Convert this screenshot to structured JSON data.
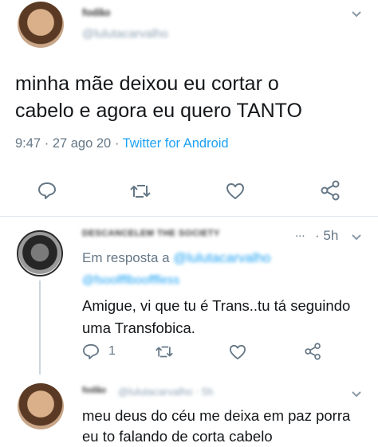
{
  "main_tweet": {
    "display_name": "fodão",
    "handle": "@lulutacarvalho",
    "text_line1": "minha mãe deixou eu cortar o",
    "text_line2": "cabelo e agora eu quero TANTO",
    "time": "9:47",
    "sep1": "·",
    "date": "27 ago 20",
    "sep2": "·",
    "source": "Twitter for Android"
  },
  "reply1": {
    "display_name": "DESCANCELEM THE SOCIETY",
    "dots": "...",
    "time": "· 5h",
    "reply_to_label": "Em resposta a",
    "reply_to_handle1": "@lulutacarvalho",
    "reply_to_handle2": "@fsoolfflboofffless",
    "text_line1": "Amigue, vi que tu é Trans..tu tá seguindo",
    "text_line2": "uma Transfobica.",
    "reply_count": "1"
  },
  "reply2": {
    "display_name": "fodão",
    "handle": "@lulutacarvalho · 5h",
    "text_line1": "meu deus do céu me deixa em paz porra",
    "text_line2": "eu to falando de corta cabelo"
  },
  "icons": [
    "chevron-down-icon",
    "reply-icon",
    "retweet-icon",
    "like-icon",
    "share-icon"
  ],
  "colors": {
    "link": "#1da1f2",
    "muted": "#657786",
    "divider": "#e1e8ed"
  }
}
